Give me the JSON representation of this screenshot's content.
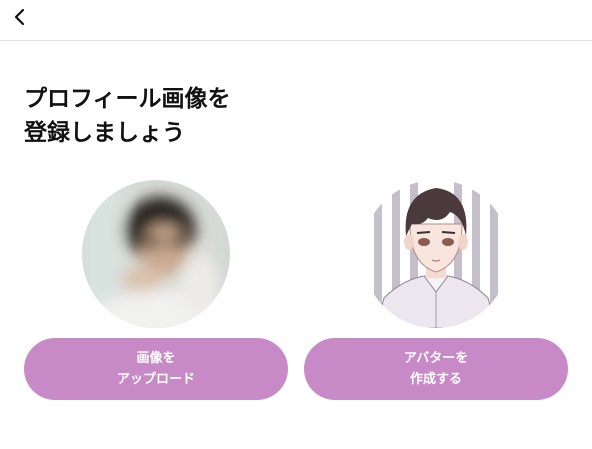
{
  "header": {
    "back_icon": "chevron-left-icon"
  },
  "page": {
    "title_line1": "プロフィール画像を",
    "title_line2": "登録しましょう"
  },
  "options": {
    "upload": {
      "label_line1": "画像を",
      "label_line2": "アップロード",
      "image": "blurred-photo-avatar"
    },
    "avatar": {
      "label_line1": "アバターを",
      "label_line2": "作成する",
      "image": "illustrated-avatar"
    }
  },
  "colors": {
    "button_bg": "#c78ac6",
    "button_text": "#ffffff",
    "title_text": "#111111",
    "divider": "#e4e4e4"
  }
}
